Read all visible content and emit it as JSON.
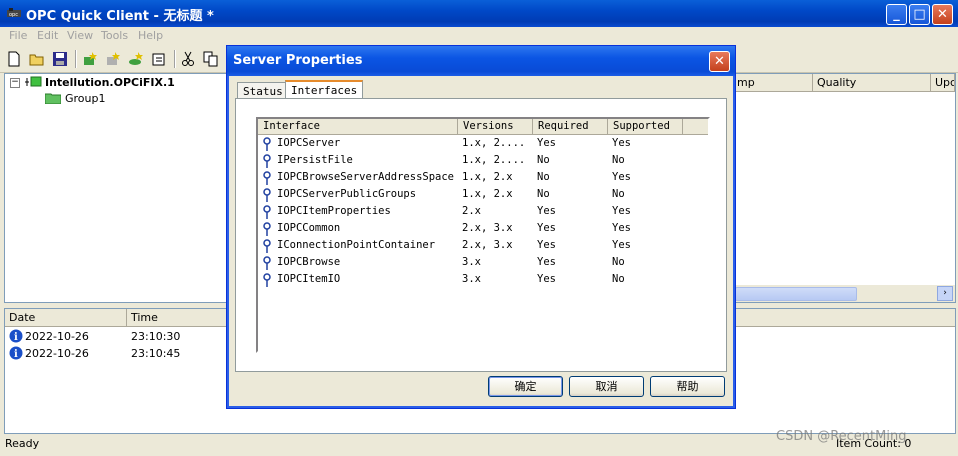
{
  "window": {
    "title": "OPC Quick Client - 无标题 *"
  },
  "menu": [
    "File",
    "Edit",
    "View",
    "Tools",
    "Help"
  ],
  "tree": {
    "server": "Intellution.OPCiFIX.1",
    "group": "Group1"
  },
  "item_list": {
    "columns": [
      "mp",
      "Quality",
      "Upc"
    ]
  },
  "log": {
    "columns": [
      "Date",
      "Time"
    ],
    "rows": [
      {
        "date": "2022-10-26",
        "time": "23:10:30"
      },
      {
        "date": "2022-10-26",
        "time": "23:10:45"
      }
    ]
  },
  "status": {
    "text": "Ready",
    "item_count": "Item Count: 0"
  },
  "watermark": "CSDN @RecentMing",
  "dialog": {
    "title": "Server Properties",
    "tabs": [
      "Status",
      "Interfaces"
    ],
    "active_tab": "Interfaces",
    "columns": [
      "Interface",
      "Versions",
      "Required",
      "Supported"
    ],
    "rows": [
      {
        "interface": "IOPCServer",
        "versions": "1.x, 2....",
        "required": "Yes",
        "supported": "Yes"
      },
      {
        "interface": "IPersistFile",
        "versions": "1.x, 2....",
        "required": "No",
        "supported": "No"
      },
      {
        "interface": "IOPCBrowseServerAddressSpace",
        "versions": "1.x, 2.x",
        "required": "No",
        "supported": "Yes"
      },
      {
        "interface": "IOPCServerPublicGroups",
        "versions": "1.x, 2.x",
        "required": "No",
        "supported": "No"
      },
      {
        "interface": "IOPCItemProperties",
        "versions": "2.x",
        "required": "Yes",
        "supported": "Yes"
      },
      {
        "interface": "IOPCCommon",
        "versions": "2.x, 3.x",
        "required": "Yes",
        "supported": "Yes"
      },
      {
        "interface": "IConnectionPointContainer",
        "versions": "2.x, 3.x",
        "required": "Yes",
        "supported": "Yes"
      },
      {
        "interface": "IOPCBrowse",
        "versions": "3.x",
        "required": "Yes",
        "supported": "No"
      },
      {
        "interface": "IOPCItemIO",
        "versions": "3.x",
        "required": "Yes",
        "supported": "No"
      }
    ],
    "buttons": {
      "ok": "确定",
      "cancel": "取消",
      "help": "帮助"
    }
  },
  "colors": {
    "title_blue": "#0048c7",
    "dialog_border": "#0831d9",
    "close_red": "#c4401c"
  }
}
